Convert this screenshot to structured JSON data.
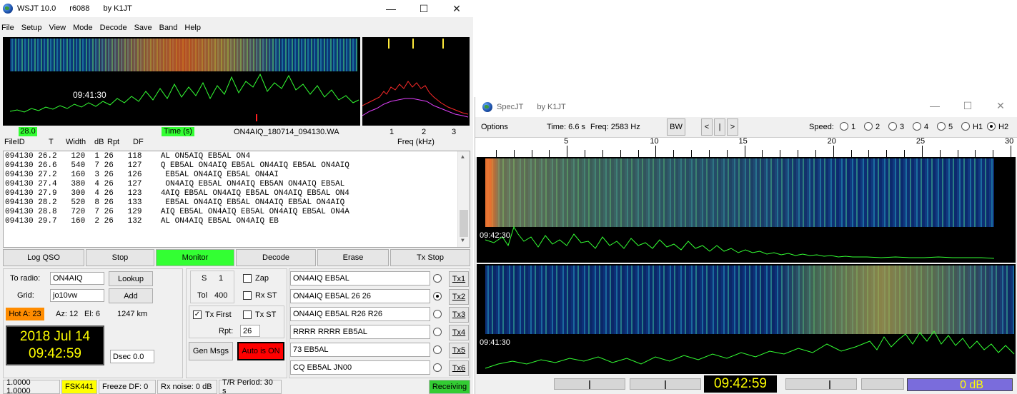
{
  "wsjt": {
    "title": "WSJT 10.0",
    "revision": "r6088",
    "author": "by K1JT",
    "menu": [
      "File",
      "Setup",
      "View",
      "Mode",
      "Decode",
      "Save",
      "Band",
      "Help"
    ],
    "waterfall_time": "09:41:30",
    "df_box": "28.0",
    "time_label": "Time (s)",
    "filename": "ON4AIQ_180714_094130.WA",
    "freq_ticks": [
      "1",
      "2",
      "3"
    ],
    "freq_label": "Freq (kHz)",
    "decode_headers": [
      "FileID",
      "T",
      "Width",
      "dB",
      "Rpt",
      "DF"
    ],
    "decodes": [
      [
        "094130",
        "26.2",
        "120",
        "1",
        "26",
        "118",
        "AL ON5AIQ EB5AL ON4"
      ],
      [
        "094130",
        "26.6",
        "540",
        "7",
        "26",
        "127",
        "Q EB5AL ON4AIQ EB5AL ON4AIQ EB5AL ON4AIQ"
      ],
      [
        "094130",
        "27.2",
        "160",
        "3",
        "26",
        "126",
        " EB5AL ON4AIQ EB5AL ON4AI"
      ],
      [
        "094130",
        "27.4",
        "380",
        "4",
        "26",
        "127",
        " ON4AIQ EB5AL ON4AIQ EB5AN ON4AIQ EB5AL"
      ],
      [
        "094130",
        "27.9",
        "300",
        "4",
        "26",
        "123",
        "4AIQ EB5AL ON4AIQ EB5AL ON4AIQ EB5AL ON4"
      ],
      [
        "094130",
        "28.2",
        "520",
        "8",
        "26",
        "133",
        " EB5AL ON4AIQ EB5AL ON4AIQ EB5AL ON4AIQ"
      ],
      [
        "094130",
        "28.8",
        "720",
        "7",
        "26",
        "129",
        "AIQ EB5AL ON4AIQ EB5AL ON4AIQ EB5AL ON4A"
      ],
      [
        "094130",
        "29.7",
        "160",
        "2",
        "26",
        "132",
        "AL ON4AIQ EB5AL ON4AIQ EB"
      ]
    ],
    "buttons": {
      "log_qso": "Log QSO",
      "stop": "Stop",
      "monitor": "Monitor",
      "decode": "Decode",
      "erase": "Erase",
      "tx_stop": "Tx Stop",
      "lookup": "Lookup",
      "add": "Add",
      "gen_msgs": "Gen Msgs",
      "auto_is": "Auto is  ON"
    },
    "to_radio_label": "To radio:",
    "to_radio": "ON4AIQ",
    "grid_label": "Grid:",
    "grid": "jo10vw",
    "hot_a": "Hot A: 23",
    "az": "Az: 12",
    "el": "El: 6",
    "km": "1247 km",
    "clock_date": "2018 Jul 14",
    "clock_time": "09:42:59",
    "dsec": "Dsec  0.0",
    "s_label": "S",
    "s_value": "1",
    "tol_label": "Tol",
    "tol_value": "400",
    "zap": "Zap",
    "rx_st": "Rx ST",
    "tx_first": "Tx First",
    "tx_st": "Tx ST",
    "rpt_label": "Rpt:",
    "rpt": "26",
    "messages": [
      {
        "text": "ON4AIQ EB5AL",
        "tx": "Tx1",
        "selected": false
      },
      {
        "text": "ON4AIQ EB5AL 26 26",
        "tx": "Tx2",
        "selected": true
      },
      {
        "text": "ON4AIQ EB5AL R26 R26",
        "tx": "Tx3",
        "selected": false
      },
      {
        "text": "RRRR RRRR EB5AL",
        "tx": "Tx4",
        "selected": false
      },
      {
        "text": "73 EB5AL",
        "tx": "Tx5",
        "selected": false
      },
      {
        "text": "CQ EB5AL JN00",
        "tx": "Tx6",
        "selected": false
      }
    ],
    "status": {
      "levels": "1.0000 1.0000",
      "mode": "FSK441",
      "freeze": "Freeze DF:   0",
      "rx_noise": "Rx noise:   0 dB",
      "tr_period": "T/R Period: 30 s",
      "state": "Receiving"
    }
  },
  "specjt": {
    "title": "SpecJT",
    "author": "by K1JT",
    "options": "Options",
    "time": "Time:  6.6 s",
    "freq": "Freq:  2583 Hz",
    "bw": "BW",
    "nav": [
      "<",
      "|",
      ">"
    ],
    "speed_label": "Speed:",
    "speeds": [
      "1",
      "2",
      "3",
      "4",
      "5",
      "H1",
      "H2"
    ],
    "speed_selected": "H2",
    "ticks": [
      "5",
      "10",
      "15",
      "20",
      "25",
      "30"
    ],
    "time_top": "09:42:30",
    "time_bottom": "09:41:30",
    "clock": "09:42:59",
    "level": "0 dB"
  },
  "colors": {
    "monitor_green": "#33ff33",
    "auto_red": "#ff0000",
    "clock_yellow": "#ffff00",
    "fsk_yellow": "#ffff00",
    "receiving_green": "#33cc33",
    "hot_orange": "#ff8c00",
    "level_blue": "#7a6cdc"
  }
}
